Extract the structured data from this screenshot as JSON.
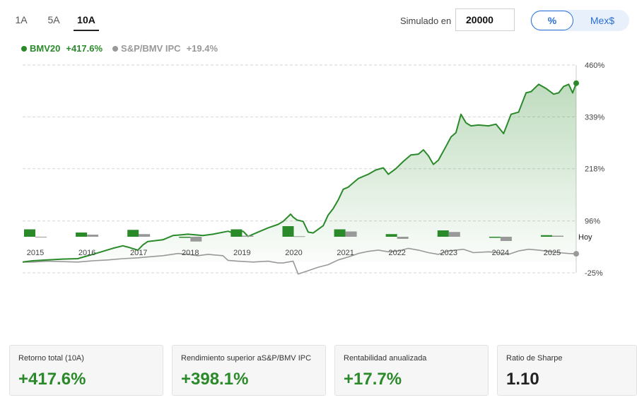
{
  "tabs": [
    {
      "label": "1A",
      "active": false
    },
    {
      "label": "5A",
      "active": false
    },
    {
      "label": "10A",
      "active": true
    }
  ],
  "simulator": {
    "label": "Simulado en",
    "value": "20000"
  },
  "toggle": {
    "percent_label": "%",
    "currency_label": "Mex$",
    "selected": "%"
  },
  "legend": [
    {
      "name": "BMV20",
      "value": "+417.6%",
      "color": "#2a8a2a"
    },
    {
      "name": "S&P/BMV IPC",
      "value": "+19.4%",
      "color": "#999999"
    }
  ],
  "chart_data": {
    "type": "line",
    "ylim": [
      -25,
      460
    ],
    "yticks": [
      "460%",
      "339%",
      "218%",
      "96%",
      "-25%"
    ],
    "ytick_values": [
      460,
      339,
      218,
      96,
      -25
    ],
    "xlim": [
      2014.8,
      2025.85
    ],
    "x_labels": [
      "2015",
      "2016",
      "2017",
      "2018",
      "2019",
      "2020",
      "2021",
      "2022",
      "2023",
      "2024",
      "2025"
    ],
    "today_label": "Hoy",
    "grid": true,
    "series": [
      {
        "name": "BMV20",
        "color": "#2a8a2a",
        "fill": true,
        "points": [
          [
            2014.8,
            0
          ],
          [
            2015.0,
            3
          ],
          [
            2015.3,
            5
          ],
          [
            2015.6,
            7
          ],
          [
            2015.9,
            8
          ],
          [
            2016.2,
            18
          ],
          [
            2016.4,
            25
          ],
          [
            2016.6,
            32
          ],
          [
            2016.8,
            38
          ],
          [
            2016.9,
            35
          ],
          [
            2017.1,
            28
          ],
          [
            2017.2,
            40
          ],
          [
            2017.3,
            48
          ],
          [
            2017.6,
            52
          ],
          [
            2017.8,
            62
          ],
          [
            2018.1,
            65
          ],
          [
            2018.4,
            62
          ],
          [
            2018.6,
            65
          ],
          [
            2018.9,
            72
          ],
          [
            2019.0,
            68
          ],
          [
            2019.2,
            72
          ],
          [
            2019.3,
            60
          ],
          [
            2019.5,
            70
          ],
          [
            2019.7,
            80
          ],
          [
            2019.9,
            88
          ],
          [
            2020.0,
            95
          ],
          [
            2020.15,
            112
          ],
          [
            2020.2,
            105
          ],
          [
            2020.28,
            98
          ],
          [
            2020.4,
            95
          ],
          [
            2020.5,
            70
          ],
          [
            2020.6,
            68
          ],
          [
            2020.8,
            85
          ],
          [
            2020.9,
            110
          ],
          [
            2021.0,
            125
          ],
          [
            2021.1,
            145
          ],
          [
            2021.2,
            170
          ],
          [
            2021.3,
            175
          ],
          [
            2021.5,
            195
          ],
          [
            2021.7,
            205
          ],
          [
            2021.85,
            215
          ],
          [
            2022.0,
            220
          ],
          [
            2022.1,
            205
          ],
          [
            2022.25,
            218
          ],
          [
            2022.4,
            235
          ],
          [
            2022.55,
            250
          ],
          [
            2022.7,
            252
          ],
          [
            2022.8,
            262
          ],
          [
            2022.9,
            248
          ],
          [
            2023.0,
            228
          ],
          [
            2023.1,
            238
          ],
          [
            2023.25,
            270
          ],
          [
            2023.35,
            292
          ],
          [
            2023.45,
            302
          ],
          [
            2023.55,
            345
          ],
          [
            2023.65,
            325
          ],
          [
            2023.75,
            318
          ],
          [
            2023.9,
            320
          ],
          [
            2024.1,
            318
          ],
          [
            2024.25,
            322
          ],
          [
            2024.4,
            300
          ],
          [
            2024.55,
            345
          ],
          [
            2024.7,
            350
          ],
          [
            2024.85,
            395
          ],
          [
            2024.95,
            398
          ],
          [
            2025.1,
            415
          ],
          [
            2025.25,
            405
          ],
          [
            2025.4,
            392
          ],
          [
            2025.5,
            395
          ],
          [
            2025.6,
            410
          ],
          [
            2025.7,
            415
          ],
          [
            2025.78,
            395
          ],
          [
            2025.85,
            417.6
          ]
        ]
      },
      {
        "name": "S&P/BMV IPC",
        "color": "#999999",
        "fill": false,
        "points": [
          [
            2014.8,
            0
          ],
          [
            2015.0,
            0
          ],
          [
            2015.3,
            2
          ],
          [
            2015.6,
            1
          ],
          [
            2015.9,
            0
          ],
          [
            2016.2,
            3
          ],
          [
            2016.5,
            5
          ],
          [
            2016.8,
            8
          ],
          [
            2017.1,
            10
          ],
          [
            2017.3,
            12
          ],
          [
            2017.6,
            15
          ],
          [
            2017.9,
            20
          ],
          [
            2018.1,
            18
          ],
          [
            2018.3,
            15
          ],
          [
            2018.5,
            18
          ],
          [
            2018.8,
            15
          ],
          [
            2018.9,
            4
          ],
          [
            2019.1,
            2
          ],
          [
            2019.4,
            0
          ],
          [
            2019.7,
            2
          ],
          [
            2019.9,
            -2
          ],
          [
            2020.0,
            -2
          ],
          [
            2020.2,
            2
          ],
          [
            2020.3,
            -28
          ],
          [
            2020.5,
            -20
          ],
          [
            2020.7,
            -12
          ],
          [
            2020.9,
            -6
          ],
          [
            2021.1,
            5
          ],
          [
            2021.3,
            12
          ],
          [
            2021.5,
            20
          ],
          [
            2021.7,
            25
          ],
          [
            2021.9,
            28
          ],
          [
            2022.1,
            24
          ],
          [
            2022.3,
            26
          ],
          [
            2022.5,
            32
          ],
          [
            2022.7,
            28
          ],
          [
            2022.9,
            22
          ],
          [
            2023.1,
            18
          ],
          [
            2023.3,
            26
          ],
          [
            2023.6,
            30
          ],
          [
            2023.8,
            22
          ],
          [
            2024.1,
            24
          ],
          [
            2024.3,
            22
          ],
          [
            2024.5,
            18
          ],
          [
            2024.7,
            26
          ],
          [
            2024.9,
            30
          ],
          [
            2025.1,
            28
          ],
          [
            2025.3,
            25
          ],
          [
            2025.5,
            22
          ],
          [
            2025.7,
            20
          ],
          [
            2025.85,
            19.4
          ]
        ]
      }
    ],
    "annual_bars": [
      {
        "year": "2015",
        "bmv20": 14,
        "ipc": -1
      },
      {
        "year": "2016",
        "bmv20": 8,
        "ipc": 4
      },
      {
        "year": "2017",
        "bmv20": 13,
        "ipc": 5
      },
      {
        "year": "2018",
        "bmv20": -2,
        "ipc": -9
      },
      {
        "year": "2019",
        "bmv20": 14,
        "ipc": 2
      },
      {
        "year": "2020",
        "bmv20": 20,
        "ipc": 1
      },
      {
        "year": "2021",
        "bmv20": 14,
        "ipc": 10
      },
      {
        "year": "2022",
        "bmv20": 5,
        "ipc": -4
      },
      {
        "year": "2023",
        "bmv20": 12,
        "ipc": 9
      },
      {
        "year": "2024",
        "bmv20": -2,
        "ipc": -8
      },
      {
        "year": "2025",
        "bmv20": 3,
        "ipc": 2
      }
    ]
  },
  "stats": [
    {
      "label": "Retorno total (10A)",
      "value": "+417.6%",
      "color": "#2a8a2a"
    },
    {
      "label": "Rendimiento superior aS&P/BMV IPC",
      "value": "+398.1%",
      "color": "#2a8a2a"
    },
    {
      "label": "Rentabilidad anualizada",
      "value": "+17.7%",
      "color": "#2a8a2a"
    },
    {
      "label": "Ratio de Sharpe",
      "value": "1.10",
      "color": "#222222"
    }
  ]
}
